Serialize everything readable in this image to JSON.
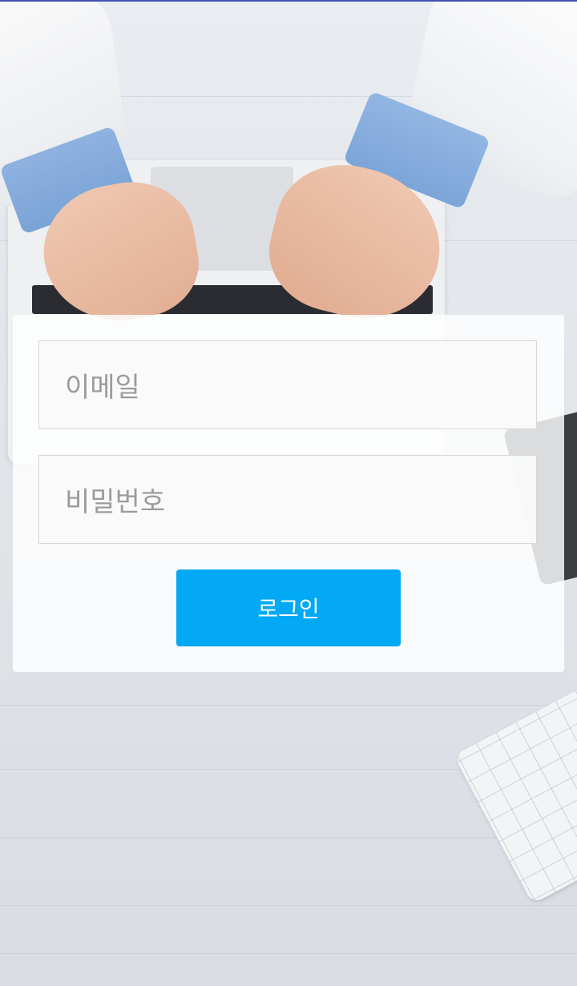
{
  "login_form": {
    "email_placeholder": "이메일",
    "password_placeholder": "비밀번호",
    "login_label": "로그인"
  },
  "colors": {
    "button": "#03a9f4",
    "button_text": "#ffffff",
    "placeholder_text": "#9b9b9b"
  }
}
